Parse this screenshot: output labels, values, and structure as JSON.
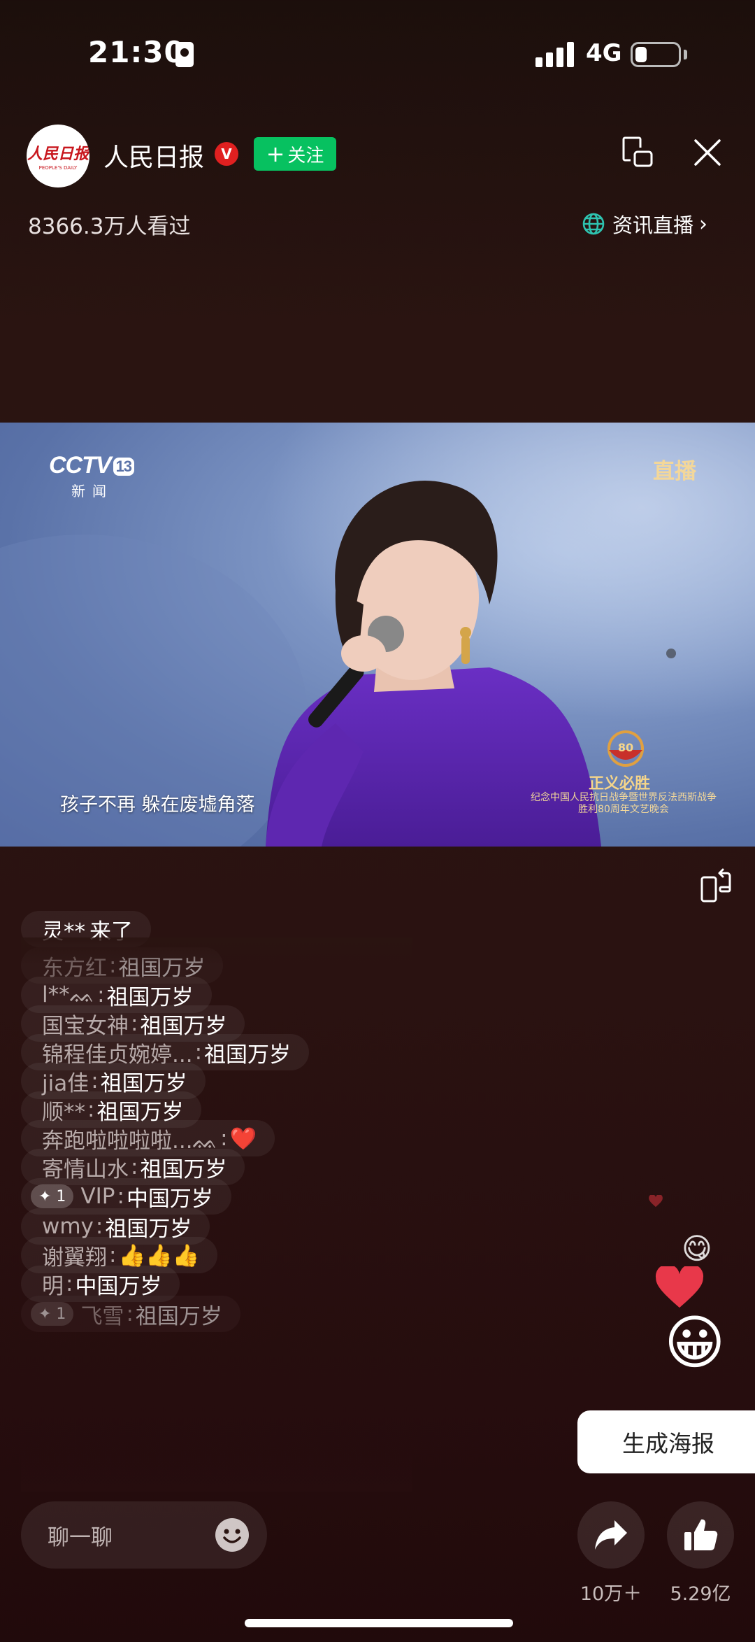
{
  "status_bar": {
    "time": "21:30",
    "network": "4G"
  },
  "header": {
    "avatar_text": "人民日报",
    "avatar_subtext": "PEOPLE'S DAILY",
    "account_name": "人民日报",
    "verified_mark": "V",
    "follow_label": "关注",
    "viewers": "8366.3万人看过",
    "channel_link": "资讯直播"
  },
  "video": {
    "channel_logo": "CCTV",
    "channel_number": "13",
    "channel_subtitle": "新闻",
    "live_label": "直播",
    "lyric": "孩子不再 躲在废墟角落",
    "event_badge_number": "80",
    "event_title": "正义必胜",
    "event_subtitle_line1": "纪念中国人民抗日战争暨世界反法西斯战争",
    "event_subtitle_line2": "胜利80周年文艺晚会"
  },
  "comments": [
    {
      "user": "灵**",
      "text": "来了",
      "type": "join"
    },
    {
      "user": "东方红",
      "text": "祖国万岁",
      "faded": true
    },
    {
      "user": "l**ᨐ",
      "text": "祖国万岁"
    },
    {
      "user": "国宝女神",
      "text": "祖国万岁"
    },
    {
      "user": "锦程佳贞婉婷...",
      "text": "祖国万岁"
    },
    {
      "user": "jia佳",
      "text": "祖国万岁"
    },
    {
      "user": "顺**",
      "text": "祖国万岁"
    },
    {
      "user": "奔跑啦啦啦啦...ᨐ",
      "text": "❤️"
    },
    {
      "user": "寄情山水",
      "text": "祖国万岁"
    },
    {
      "user": "VIP",
      "text": "中国万岁",
      "badge": "✦ 1"
    },
    {
      "user": "wmy",
      "text": "祖国万岁"
    },
    {
      "user": "谢翼翔",
      "text": "👍👍👍"
    },
    {
      "user": "明",
      "text": "中国万岁"
    },
    {
      "user": "飞雪",
      "text": "祖国万岁",
      "badge": "✦ 1",
      "faded": true
    }
  ],
  "floating": {
    "emoji_small": "😋",
    "emoji_big": "😀"
  },
  "poster_button": "生成海报",
  "bottom": {
    "chat_placeholder": "聊一聊",
    "share_count": "10万＋",
    "like_count": "5.29亿"
  },
  "colors": {
    "follow_green": "#07c160",
    "verified_red": "#e02020",
    "accent_gold": "#f5d58a"
  }
}
